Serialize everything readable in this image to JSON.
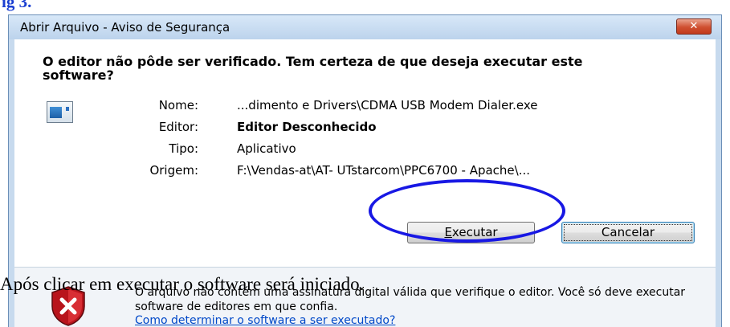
{
  "figure_label": "ig 3.",
  "dialog": {
    "title": "Abrir Arquivo - Aviso de Segurança",
    "close_symbol": "✕",
    "headline": "O editor não pôde ser verificado.  Tem certeza de que deseja executar este software?",
    "app_icon": "application-window-icon",
    "details": [
      {
        "label": "Nome:",
        "value": "...dimento e Drivers\\CDMA USB Modem Dialer.exe",
        "bold": false
      },
      {
        "label": "Editor:",
        "value": "Editor Desconhecido",
        "bold": true
      },
      {
        "label": "Tipo:",
        "value": "Aplicativo",
        "bold": false
      },
      {
        "label": "Origem:",
        "value": "F:\\Vendas-at\\AT- UTstarcom\\PPC6700 - Apache\\...",
        "bold": false
      }
    ],
    "buttons": {
      "execute_underlined": "E",
      "execute_rest": "xecutar",
      "cancel": "Cancelar"
    },
    "footer": {
      "shield_icon": "security-shield-icon",
      "text": "O arquivo não contém uma assinatura digital válida que verifique o editor. Você só deve executar software de editores em que confia.",
      "link": "Como determinar o software a ser executado?"
    }
  },
  "annotation": {
    "highlight_color": "#1818e4",
    "caption": "Após clicar em executar o software será iniciado."
  }
}
